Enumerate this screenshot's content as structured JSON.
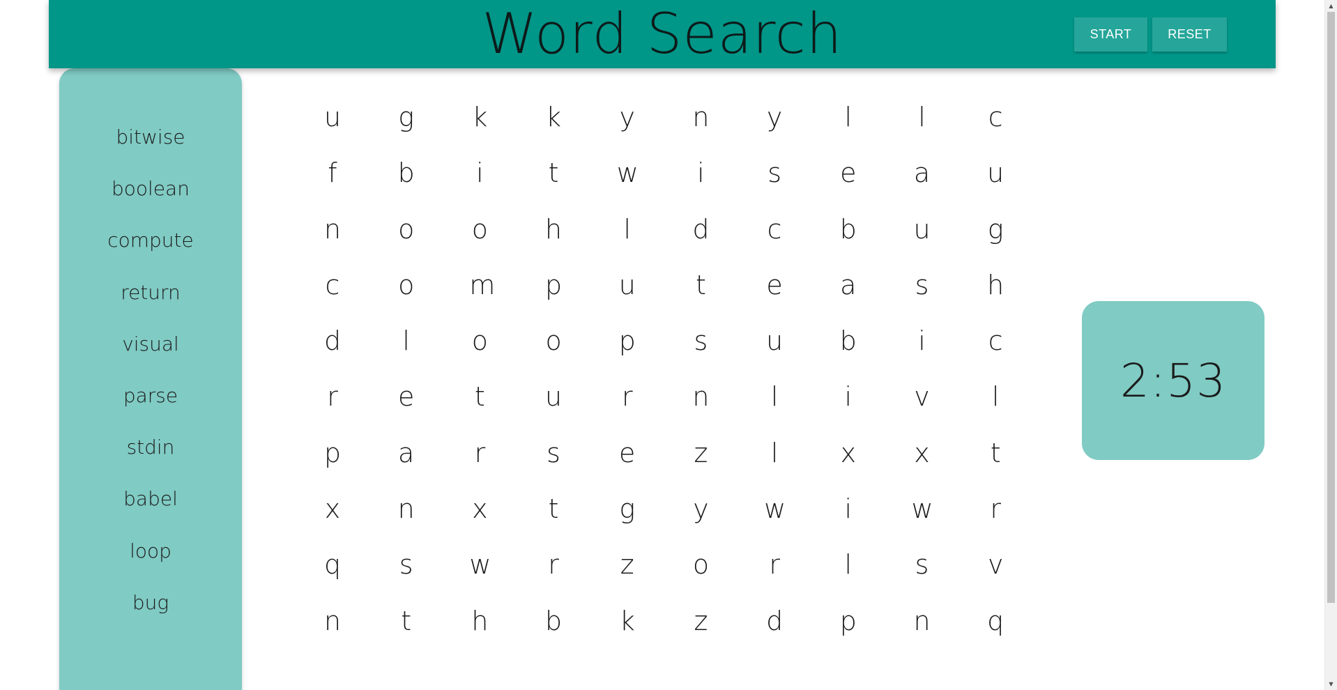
{
  "header": {
    "title": "Word Search",
    "start_label": "START",
    "reset_label": "RESET",
    "background_color": "#009688",
    "button_color": "#26a69a"
  },
  "word_list": {
    "words": [
      "bitwise",
      "boolean",
      "compute",
      "return",
      "visual",
      "parse",
      "stdin",
      "babel",
      "loop",
      "bug"
    ],
    "background_color": "#80cbc4"
  },
  "grid": {
    "rows": [
      [
        "u",
        "g",
        "k",
        "k",
        "y",
        "n",
        "y",
        "l",
        "l",
        "c"
      ],
      [
        "f",
        "b",
        "i",
        "t",
        "w",
        "i",
        "s",
        "e",
        "a",
        "u"
      ],
      [
        "n",
        "o",
        "o",
        "h",
        "l",
        "d",
        "c",
        "b",
        "u",
        "g"
      ],
      [
        "c",
        "o",
        "m",
        "p",
        "u",
        "t",
        "e",
        "a",
        "s",
        "h"
      ],
      [
        "d",
        "l",
        "o",
        "o",
        "p",
        "s",
        "u",
        "b",
        "i",
        "c"
      ],
      [
        "r",
        "e",
        "t",
        "u",
        "r",
        "n",
        "l",
        "i",
        "v",
        "l"
      ],
      [
        "p",
        "a",
        "r",
        "s",
        "e",
        "z",
        "l",
        "x",
        "x",
        "t"
      ],
      [
        "x",
        "n",
        "x",
        "t",
        "g",
        "y",
        "w",
        "i",
        "w",
        "r"
      ],
      [
        "q",
        "s",
        "w",
        "r",
        "z",
        "o",
        "r",
        "l",
        "s",
        "v"
      ],
      [
        "n",
        "t",
        "h",
        "b",
        "k",
        "z",
        "d",
        "p",
        "n",
        "q"
      ]
    ]
  },
  "timer": {
    "value": "2:53",
    "background_color": "#80cbc4"
  },
  "scrollbar": {
    "up_icon": "triangle-up",
    "down_icon": "triangle-down"
  }
}
